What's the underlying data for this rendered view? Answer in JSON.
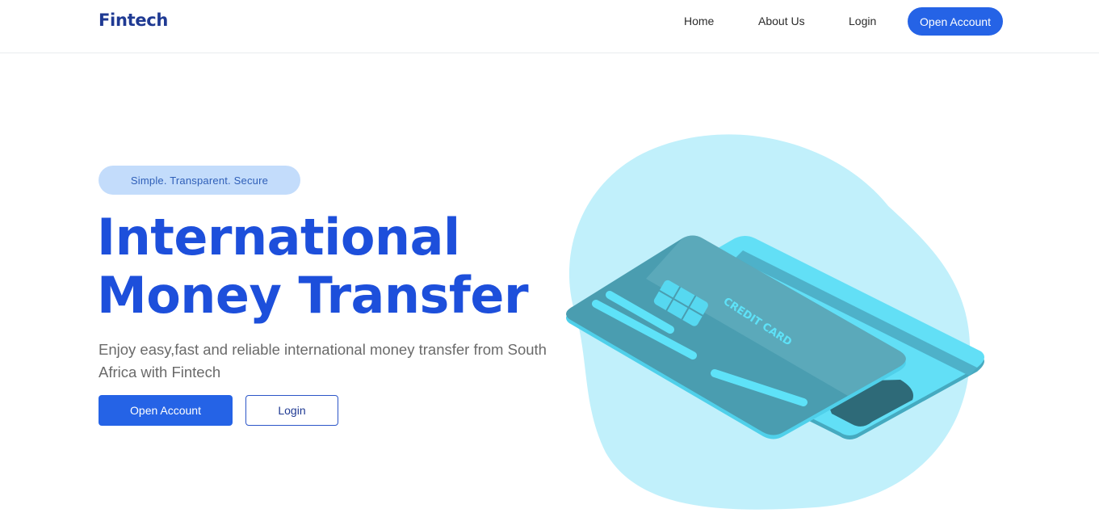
{
  "navbar": {
    "brand": "Fintech",
    "links": [
      {
        "label": "Home"
      },
      {
        "label": "About Us"
      },
      {
        "label": "Login"
      }
    ],
    "cta_label": "Open Account"
  },
  "hero": {
    "tagline": "Simple. Transparent. Secure",
    "title_line1": "International",
    "title_line2": "Money Transfer",
    "description": "Enjoy easy,fast and reliable international money transfer from South Africa with Fintech",
    "primary_button": "Open Account",
    "secondary_button": "Login"
  },
  "illustration": {
    "card_text": "CREDIT CARD",
    "blob_color": "#c1f0fb",
    "card_color": "#5bc7de"
  },
  "colors": {
    "brand": "#1f3a93",
    "accent": "#2563e6",
    "headline": "#1d4fdb",
    "pill_bg": "#c3dcfb"
  }
}
